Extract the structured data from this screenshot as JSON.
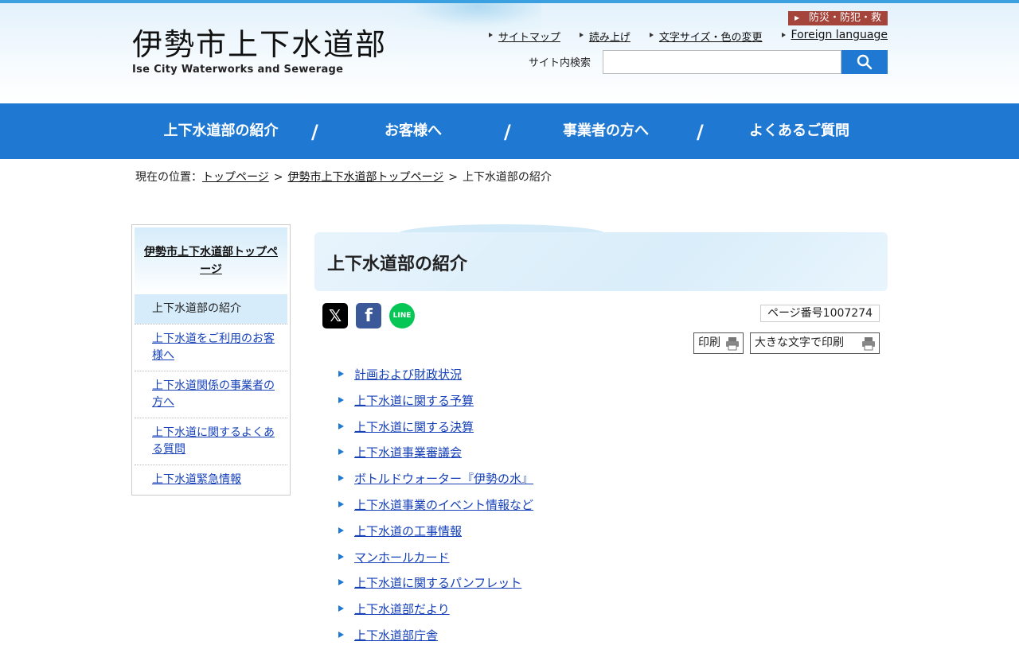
{
  "header": {
    "logo_jp": "伊勢市上下水道部",
    "logo_en": "Ise City Waterworks and Sewerage",
    "emergency_label": "防災・防犯・救急",
    "util_links": [
      "サイトマップ",
      "読み上げ",
      "文字サイズ・色の変更",
      "Foreign language"
    ],
    "search_label": "サイト内検索",
    "search_placeholder": ""
  },
  "gnav": [
    "上下水道部の紹介",
    "お客様へ",
    "事業者の方へ",
    "よくあるご質問"
  ],
  "breadcrumb": {
    "prefix": "現在の位置：",
    "items": [
      "トップページ",
      "伊勢市上下水道部トップページ",
      "上下水道部の紹介"
    ]
  },
  "sidebar": {
    "heading": "伊勢市上下水道部トップページ",
    "items": [
      "上下水道部の紹介",
      "上下水道をご利用のお客様へ",
      "上下水道関係の事業者の方へ",
      "上下水道に関するよくある質問",
      "上下水道緊急情報"
    ]
  },
  "main": {
    "title": "上下水道部の紹介",
    "page_number": "ページ番号1007274",
    "print_label": "印刷",
    "print_large_label": "大きな文字で印刷",
    "social": [
      "x-icon",
      "facebook-icon",
      "line-icon"
    ],
    "links": [
      "計画および財政状況",
      "上下水道に関する予算",
      "上下水道に関する決算",
      "上下水道事業審議会",
      "ボトルドウォーター『伊勢の水』",
      "上下水道事業のイベント情報など",
      "上下水道の工事情報",
      "マンホールカード",
      "上下水道に関するパンフレット",
      "上下水道部だより",
      "上下水道部庁舎"
    ]
  },
  "colors": {
    "primary": "#1f78d1",
    "emergency": "#a5443a",
    "link": "#1540b8"
  }
}
